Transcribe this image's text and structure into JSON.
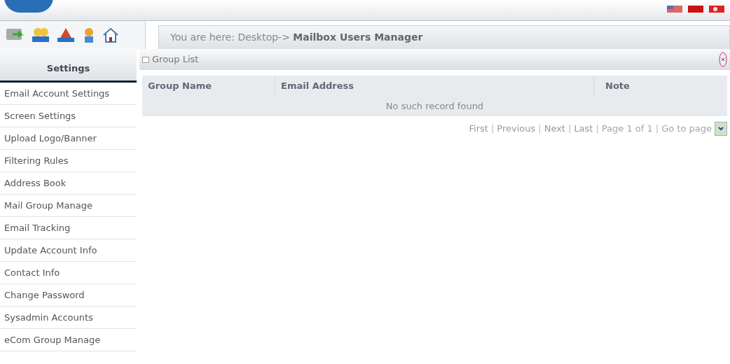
{
  "breadcrumb": {
    "label": "You are here: Desktop->",
    "current": "Mailbox Users Manager"
  },
  "sidebar": {
    "title": "Settings",
    "items": [
      "Email Account Settings",
      "Screen Settings",
      "Upload Logo/Banner",
      "Filtering Rules",
      "Address Book",
      "Mail Group Manage",
      "Email Tracking",
      "Update Account Info",
      "Contact Info",
      "Change Password",
      "Sysadmin Accounts",
      "eCom Group Manage"
    ]
  },
  "panel": {
    "title": "Group List",
    "columns": [
      "Group Name",
      "Email Address",
      "Note"
    ],
    "empty_message": "No such record found",
    "pager": [
      {
        "kind": "link",
        "text": "First"
      },
      {
        "kind": "separator",
        "text": "|"
      },
      {
        "kind": "link",
        "text": "Previous"
      },
      {
        "kind": "separator",
        "text": "|"
      },
      {
        "kind": "link",
        "text": "Next"
      },
      {
        "kind": "separator",
        "text": "|"
      },
      {
        "kind": "link",
        "text": "Last"
      },
      {
        "kind": "separator",
        "text": "|"
      },
      {
        "kind": "label",
        "text": "Page 1 of 1"
      },
      {
        "kind": "separator",
        "text": "|"
      },
      {
        "kind": "label",
        "text": "Go to page"
      }
    ]
  }
}
